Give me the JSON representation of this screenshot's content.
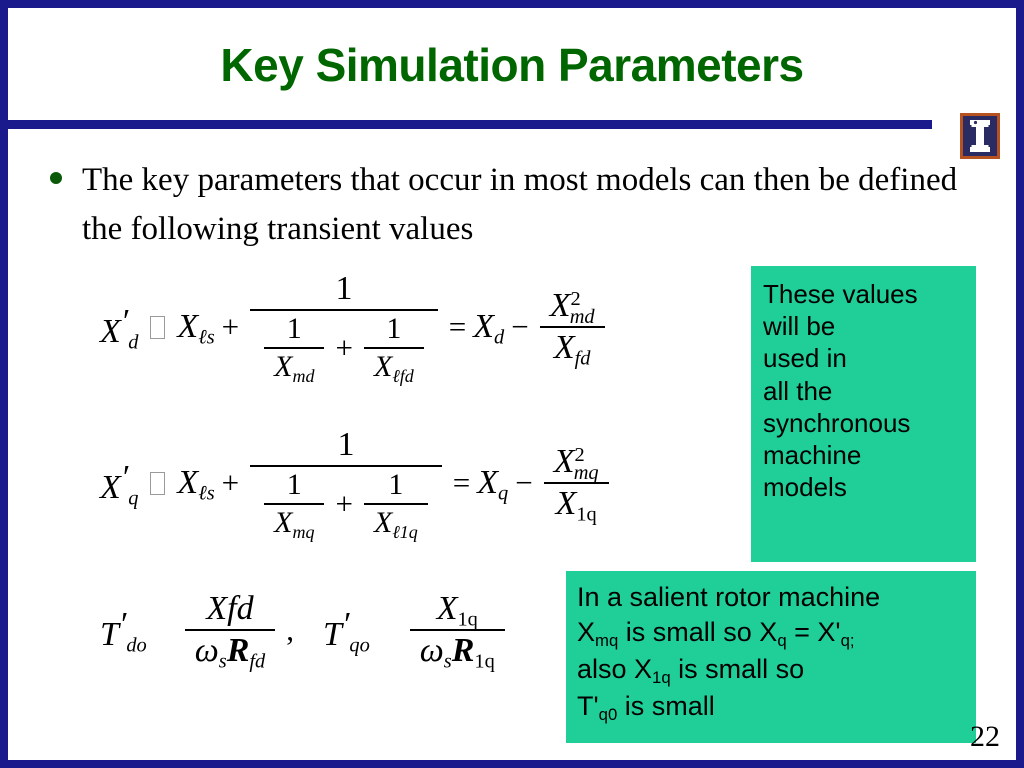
{
  "slide": {
    "title": "Key Simulation Parameters",
    "title_color": "#006600",
    "border_color": "#1a1a8c",
    "rule_color": "#1a1a8c",
    "callout_color": "#1fcf97",
    "page_number": "22",
    "logo_name": "university-of-illinois-block-i-logo"
  },
  "bullet": {
    "text": "The key parameters that occur in most models can then be defined the following transient values"
  },
  "equations": [
    {
      "id": "xd-prime",
      "plain": "X'd ≈ Xℓs + 1 / (1/Xmd + 1/Xℓfd) = Xd − X²md / Xfd",
      "lhs_var": "X",
      "lhs_sub": "d",
      "prime": "′",
      "term1_var": "X",
      "term1_sub": "ℓs",
      "plus": "+",
      "frac_num": "1",
      "d1_num": "1",
      "d1_den_var": "X",
      "d1_den_sub": "md",
      "d_plus": "+",
      "d2_num": "1",
      "d2_den_var": "X",
      "d2_den_sub": "ℓfd",
      "equals": "=",
      "rhs_var": "X",
      "rhs_sub": "d",
      "minus": "−",
      "rfrac_num_var": "X",
      "rfrac_num_sub": "md",
      "rfrac_num_sup": "2",
      "rfrac_den_var": "X",
      "rfrac_den_sub": "fd"
    },
    {
      "id": "xq-prime",
      "plain": "X'q ≈ Xℓs + 1 / (1/Xmq + 1/Xℓ1q) = Xq − X²mq / X1q",
      "lhs_var": "X",
      "lhs_sub": "q",
      "prime": "′",
      "term1_var": "X",
      "term1_sub": "ℓs",
      "plus": "+",
      "frac_num": "1",
      "d1_num": "1",
      "d1_den_var": "X",
      "d1_den_sub": "mq",
      "d_plus": "+",
      "d2_num": "1",
      "d2_den_var": "X",
      "d2_den_sub": "ℓ1q",
      "equals": "=",
      "rhs_var": "X",
      "rhs_sub": "q",
      "minus": "−",
      "rfrac_num_var": "X",
      "rfrac_num_sub": "mq",
      "rfrac_num_sup": "2",
      "rfrac_den_var": "X",
      "rfrac_den_sub": "1q"
    }
  ],
  "time_constants": {
    "plain": "T'do  Xfd / (ωs Rfd) ,  T'qo  X1q / (ωs R1q)",
    "t1_var": "T",
    "t1_sub": "do",
    "t1_prime": "′",
    "t1_num": "Xfd",
    "t1_den_omega": "ω",
    "t1_den_omega_sub": "s",
    "t1_den_r": "R",
    "t1_den_r_sub": "fd",
    "comma": ",",
    "t2_var": "T",
    "t2_sub": "qo",
    "t2_prime": "′",
    "t2_num_var": "X",
    "t2_num_sub": "1q",
    "t2_den_omega": "ω",
    "t2_den_omega_sub": "s",
    "t2_den_r": "R",
    "t2_den_r_sub": "1q"
  },
  "callouts": [
    {
      "id": "callout-values",
      "lines": [
        "These values",
        "will be",
        "used in",
        "all the",
        "synchronous",
        "machine",
        "models"
      ]
    },
    {
      "id": "callout-salient",
      "line1": "In a salient rotor machine",
      "line2_a": "X",
      "line2_sub1": "mq",
      "line2_b": " is small so X",
      "line2_sub2": "q",
      "line2_c": " = X'",
      "line2_sub3": "q;",
      "line3_a": "also X",
      "line3_sub1": "1q",
      "line3_b": " is small so",
      "line4_a": "T'",
      "line4_sub1": "q0",
      "line4_b": " is small"
    }
  ]
}
